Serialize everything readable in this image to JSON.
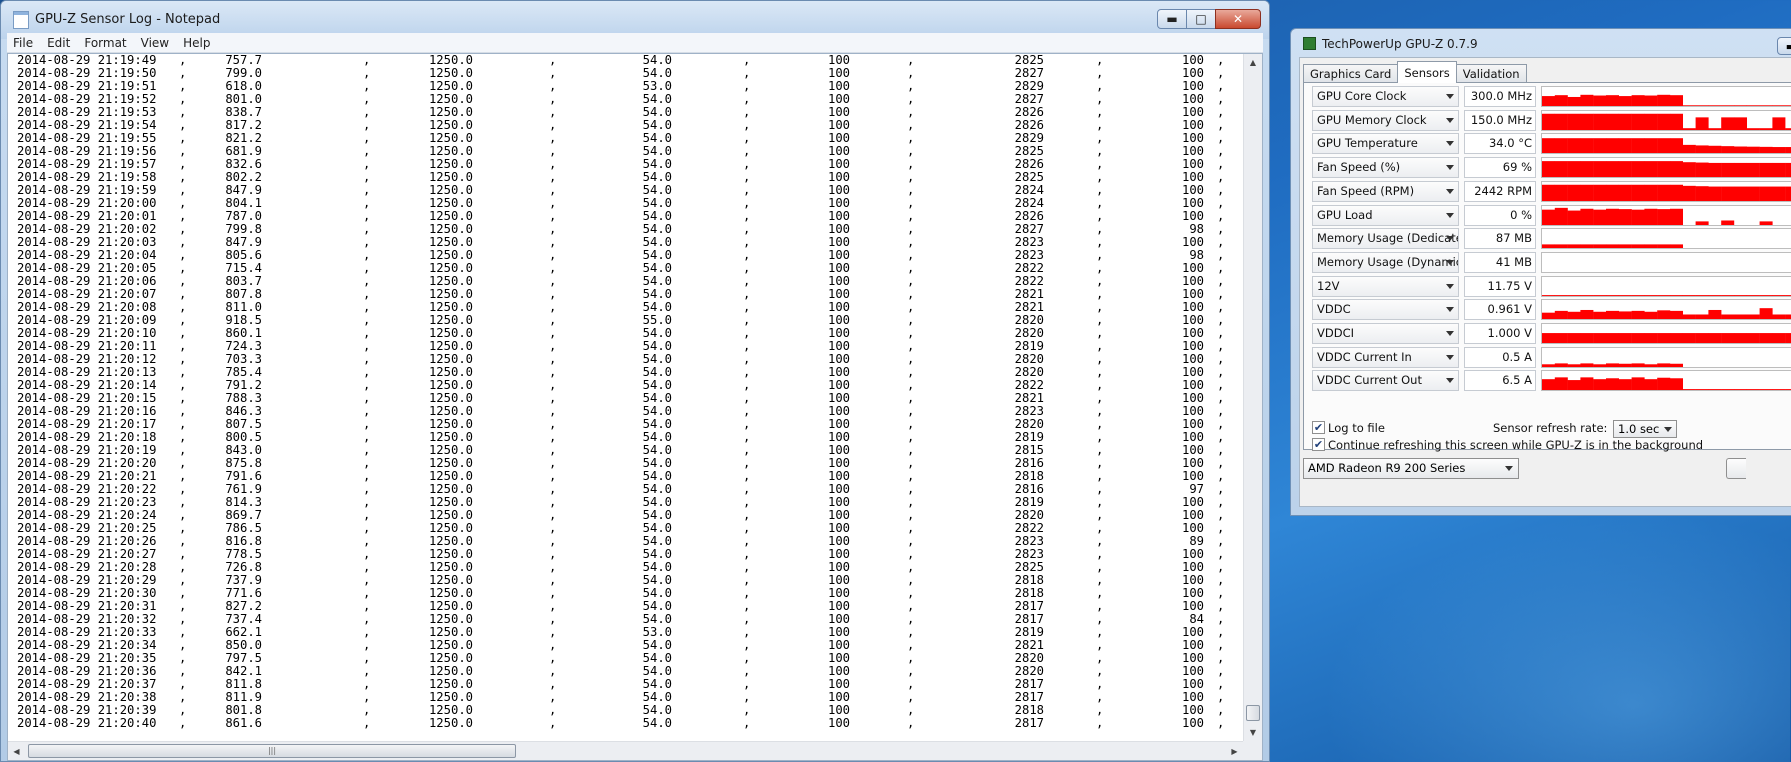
{
  "notepad": {
    "title": "GPU-Z Sensor Log - Notepad",
    "menu": [
      "File",
      "Edit",
      "Format",
      "View",
      "Help"
    ],
    "separator": ",",
    "rows": [
      [
        "2014-08-29 21:19:49",
        "757.7",
        "1250.0",
        "54.0",
        "100",
        "2825",
        "100"
      ],
      [
        "2014-08-29 21:19:50",
        "799.0",
        "1250.0",
        "54.0",
        "100",
        "2827",
        "100"
      ],
      [
        "2014-08-29 21:19:51",
        "618.0",
        "1250.0",
        "53.0",
        "100",
        "2829",
        "100"
      ],
      [
        "2014-08-29 21:19:52",
        "801.0",
        "1250.0",
        "54.0",
        "100",
        "2827",
        "100"
      ],
      [
        "2014-08-29 21:19:53",
        "838.7",
        "1250.0",
        "54.0",
        "100",
        "2826",
        "100"
      ],
      [
        "2014-08-29 21:19:54",
        "817.2",
        "1250.0",
        "54.0",
        "100",
        "2826",
        "100"
      ],
      [
        "2014-08-29 21:19:55",
        "821.2",
        "1250.0",
        "54.0",
        "100",
        "2829",
        "100"
      ],
      [
        "2014-08-29 21:19:56",
        "681.9",
        "1250.0",
        "54.0",
        "100",
        "2825",
        "100"
      ],
      [
        "2014-08-29 21:19:57",
        "832.6",
        "1250.0",
        "54.0",
        "100",
        "2826",
        "100"
      ],
      [
        "2014-08-29 21:19:58",
        "802.2",
        "1250.0",
        "54.0",
        "100",
        "2825",
        "100"
      ],
      [
        "2014-08-29 21:19:59",
        "847.9",
        "1250.0",
        "54.0",
        "100",
        "2824",
        "100"
      ],
      [
        "2014-08-29 21:20:00",
        "804.1",
        "1250.0",
        "54.0",
        "100",
        "2824",
        "100"
      ],
      [
        "2014-08-29 21:20:01",
        "787.0",
        "1250.0",
        "54.0",
        "100",
        "2826",
        "100"
      ],
      [
        "2014-08-29 21:20:02",
        "799.8",
        "1250.0",
        "54.0",
        "100",
        "2827",
        "98"
      ],
      [
        "2014-08-29 21:20:03",
        "847.9",
        "1250.0",
        "54.0",
        "100",
        "2823",
        "100"
      ],
      [
        "2014-08-29 21:20:04",
        "805.6",
        "1250.0",
        "54.0",
        "100",
        "2823",
        "98"
      ],
      [
        "2014-08-29 21:20:05",
        "715.4",
        "1250.0",
        "54.0",
        "100",
        "2822",
        "100"
      ],
      [
        "2014-08-29 21:20:06",
        "803.7",
        "1250.0",
        "54.0",
        "100",
        "2822",
        "100"
      ],
      [
        "2014-08-29 21:20:07",
        "807.8",
        "1250.0",
        "54.0",
        "100",
        "2821",
        "100"
      ],
      [
        "2014-08-29 21:20:08",
        "811.0",
        "1250.0",
        "54.0",
        "100",
        "2821",
        "100"
      ],
      [
        "2014-08-29 21:20:09",
        "918.5",
        "1250.0",
        "55.0",
        "100",
        "2820",
        "100"
      ],
      [
        "2014-08-29 21:20:10",
        "860.1",
        "1250.0",
        "54.0",
        "100",
        "2820",
        "100"
      ],
      [
        "2014-08-29 21:20:11",
        "724.3",
        "1250.0",
        "54.0",
        "100",
        "2819",
        "100"
      ],
      [
        "2014-08-29 21:20:12",
        "703.3",
        "1250.0",
        "54.0",
        "100",
        "2820",
        "100"
      ],
      [
        "2014-08-29 21:20:13",
        "785.4",
        "1250.0",
        "54.0",
        "100",
        "2820",
        "100"
      ],
      [
        "2014-08-29 21:20:14",
        "791.2",
        "1250.0",
        "54.0",
        "100",
        "2822",
        "100"
      ],
      [
        "2014-08-29 21:20:15",
        "788.3",
        "1250.0",
        "54.0",
        "100",
        "2821",
        "100"
      ],
      [
        "2014-08-29 21:20:16",
        "846.3",
        "1250.0",
        "54.0",
        "100",
        "2823",
        "100"
      ],
      [
        "2014-08-29 21:20:17",
        "807.5",
        "1250.0",
        "54.0",
        "100",
        "2820",
        "100"
      ],
      [
        "2014-08-29 21:20:18",
        "800.5",
        "1250.0",
        "54.0",
        "100",
        "2819",
        "100"
      ],
      [
        "2014-08-29 21:20:19",
        "843.0",
        "1250.0",
        "54.0",
        "100",
        "2815",
        "100"
      ],
      [
        "2014-08-29 21:20:20",
        "875.8",
        "1250.0",
        "54.0",
        "100",
        "2816",
        "100"
      ],
      [
        "2014-08-29 21:20:21",
        "791.6",
        "1250.0",
        "54.0",
        "100",
        "2818",
        "100"
      ],
      [
        "2014-08-29 21:20:22",
        "761.9",
        "1250.0",
        "54.0",
        "100",
        "2816",
        "97"
      ],
      [
        "2014-08-29 21:20:23",
        "814.3",
        "1250.0",
        "54.0",
        "100",
        "2819",
        "100"
      ],
      [
        "2014-08-29 21:20:24",
        "869.7",
        "1250.0",
        "54.0",
        "100",
        "2820",
        "100"
      ],
      [
        "2014-08-29 21:20:25",
        "786.5",
        "1250.0",
        "54.0",
        "100",
        "2822",
        "100"
      ],
      [
        "2014-08-29 21:20:26",
        "816.8",
        "1250.0",
        "54.0",
        "100",
        "2823",
        "89"
      ],
      [
        "2014-08-29 21:20:27",
        "778.5",
        "1250.0",
        "54.0",
        "100",
        "2823",
        "100"
      ],
      [
        "2014-08-29 21:20:28",
        "726.8",
        "1250.0",
        "54.0",
        "100",
        "2825",
        "100"
      ],
      [
        "2014-08-29 21:20:29",
        "737.9",
        "1250.0",
        "54.0",
        "100",
        "2818",
        "100"
      ],
      [
        "2014-08-29 21:20:30",
        "771.6",
        "1250.0",
        "54.0",
        "100",
        "2818",
        "100"
      ],
      [
        "2014-08-29 21:20:31",
        "827.2",
        "1250.0",
        "54.0",
        "100",
        "2817",
        "100"
      ],
      [
        "2014-08-29 21:20:32",
        "737.4",
        "1250.0",
        "54.0",
        "100",
        "2817",
        "84"
      ],
      [
        "2014-08-29 21:20:33",
        "662.1",
        "1250.0",
        "53.0",
        "100",
        "2819",
        "100"
      ],
      [
        "2014-08-29 21:20:34",
        "850.0",
        "1250.0",
        "54.0",
        "100",
        "2821",
        "100"
      ],
      [
        "2014-08-29 21:20:35",
        "797.5",
        "1250.0",
        "54.0",
        "100",
        "2820",
        "100"
      ],
      [
        "2014-08-29 21:20:36",
        "842.1",
        "1250.0",
        "54.0",
        "100",
        "2820",
        "100"
      ],
      [
        "2014-08-29 21:20:37",
        "811.8",
        "1250.0",
        "54.0",
        "100",
        "2817",
        "100"
      ],
      [
        "2014-08-29 21:20:38",
        "811.9",
        "1250.0",
        "54.0",
        "100",
        "2817",
        "100"
      ],
      [
        "2014-08-29 21:20:39",
        "801.8",
        "1250.0",
        "54.0",
        "100",
        "2818",
        "100"
      ],
      [
        "2014-08-29 21:20:40",
        "861.6",
        "1250.0",
        "54.0",
        "100",
        "2817",
        "100"
      ]
    ]
  },
  "gpuz": {
    "title": "TechPowerUp GPU-Z 0.7.9",
    "tabs": [
      "Graphics Card",
      "Sensors",
      "Validation"
    ],
    "active_tab": "Sensors",
    "graph_color": "#ff0000",
    "sensors": [
      {
        "name": "GPU Core Clock",
        "value": "300.0 MHz",
        "trace": [
          0.55,
          0.6,
          0.5,
          0.62,
          0.58,
          0.6,
          0.55,
          0.6,
          0.58,
          0.62,
          0.6,
          0.04,
          0.04,
          0.04,
          0.04,
          0.04,
          0.04,
          0.04,
          0.04,
          0.04
        ]
      },
      {
        "name": "GPU Memory Clock",
        "value": "150.0 MHz",
        "trace": [
          0.9,
          0.9,
          0.9,
          0.9,
          0.9,
          0.9,
          0.9,
          0.9,
          0.9,
          0.9,
          0.9,
          0.1,
          0.7,
          0.1,
          0.7,
          0.7,
          0.1,
          0.1,
          0.7,
          0.1
        ]
      },
      {
        "name": "GPU Temperature",
        "value": "34.0 °C",
        "trace": [
          0.82,
          0.82,
          0.82,
          0.82,
          0.82,
          0.82,
          0.82,
          0.82,
          0.82,
          0.82,
          0.82,
          0.45,
          0.42,
          0.4,
          0.38,
          0.36,
          0.35,
          0.34,
          0.33,
          0.33
        ]
      },
      {
        "name": "Fan Speed (%)",
        "value": "69 %",
        "trace": [
          0.88,
          0.88,
          0.88,
          0.88,
          0.88,
          0.88,
          0.88,
          0.88,
          0.88,
          0.88,
          0.88,
          0.82,
          0.8,
          0.78,
          0.78,
          0.78,
          0.78,
          0.78,
          0.78,
          0.78
        ]
      },
      {
        "name": "Fan Speed (RPM)",
        "value": "2442 RPM",
        "trace": [
          0.9,
          0.9,
          0.9,
          0.9,
          0.9,
          0.9,
          0.9,
          0.9,
          0.9,
          0.9,
          0.9,
          0.84,
          0.82,
          0.8,
          0.8,
          0.8,
          0.8,
          0.8,
          0.8,
          0.8
        ]
      },
      {
        "name": "GPU Load",
        "value": "0 %",
        "trace": [
          0.85,
          0.95,
          0.8,
          0.9,
          0.85,
          0.9,
          0.88,
          0.85,
          0.9,
          0.88,
          0.9,
          0.0,
          0.2,
          0.0,
          0.25,
          0.0,
          0.0,
          0.2,
          0.0,
          0.0
        ]
      },
      {
        "name": "Memory Usage (Dedicated)",
        "value": "87 MB",
        "trace": [
          0.2,
          0.2,
          0.2,
          0.2,
          0.2,
          0.2,
          0.2,
          0.2,
          0.2,
          0.2,
          0.2,
          0,
          0,
          0,
          0,
          0,
          0,
          0,
          0,
          0
        ]
      },
      {
        "name": "Memory Usage (Dynamic)",
        "value": "41 MB",
        "trace": [
          0,
          0,
          0,
          0,
          0,
          0,
          0,
          0,
          0,
          0,
          0,
          0,
          0,
          0,
          0,
          0,
          0,
          0,
          0,
          0
        ]
      },
      {
        "name": "12V",
        "value": "11.75 V",
        "trace": [
          0.05,
          0.05,
          0.05,
          0.05,
          0.05,
          0.05,
          0.05,
          0.05,
          0.05,
          0.05,
          0.05,
          0.05,
          0.05,
          0.05,
          0.05,
          0.05,
          0.05,
          0.05,
          0.05,
          0.05
        ]
      },
      {
        "name": "VDDC",
        "value": "0.961 V",
        "trace": [
          0.35,
          0.45,
          0.4,
          0.5,
          0.4,
          0.45,
          0.42,
          0.45,
          0.4,
          0.48,
          0.45,
          0.25,
          0.25,
          0.5,
          0.25,
          0.25,
          0.25,
          0.6,
          0.25,
          0.25
        ]
      },
      {
        "name": "VDDCI",
        "value": "1.000 V",
        "trace": [
          0.55,
          0.55,
          0.55,
          0.55,
          0.55,
          0.55,
          0.55,
          0.55,
          0.55,
          0.55,
          0.55,
          0.55,
          0.55,
          0.55,
          0.55,
          0.55,
          0.55,
          0.55,
          0.55,
          0.55
        ]
      },
      {
        "name": "VDDC Current In",
        "value": "0.5 A",
        "trace": [
          0.15,
          0.2,
          0.15,
          0.2,
          0.15,
          0.2,
          0.18,
          0.2,
          0.15,
          0.2,
          0.18,
          0,
          0,
          0,
          0,
          0,
          0,
          0,
          0,
          0
        ]
      },
      {
        "name": "VDDC Current Out",
        "value": "6.5 A",
        "trace": [
          0.6,
          0.7,
          0.55,
          0.7,
          0.6,
          0.65,
          0.6,
          0.7,
          0.6,
          0.68,
          0.65,
          0.05,
          0.05,
          0.05,
          0.05,
          0.05,
          0.05,
          0.05,
          0.05,
          0.05
        ]
      }
    ],
    "log_to_file_label": "Log to file",
    "log_to_file_checked": true,
    "refresh_rate_label": "Sensor refresh rate:",
    "refresh_rate_value": "1.0 sec",
    "background_label": "Continue refreshing this screen while GPU-Z is in the background",
    "background_checked": true,
    "device": "AMD Radeon R9 200 Series"
  }
}
